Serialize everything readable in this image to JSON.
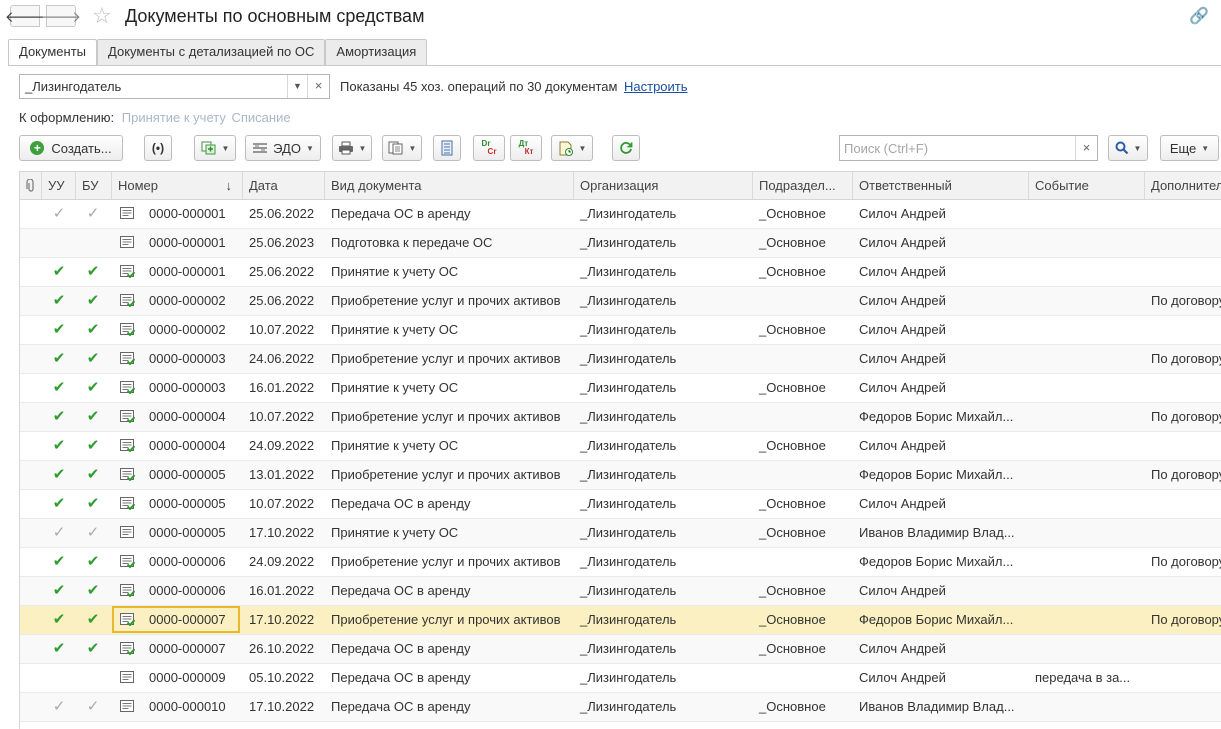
{
  "window": {
    "title": "Документы по основным средствам",
    "back": "🡐",
    "forward": "🡒",
    "favorite": "☆",
    "link": "🔗"
  },
  "tabs": [
    {
      "label": "Документы",
      "active": true
    },
    {
      "label": "Документы с детализацией по ОС",
      "active": false
    },
    {
      "label": "Амортизация",
      "active": false
    }
  ],
  "filter": {
    "value": "_Лизингодатель",
    "dropdown": "▼",
    "clear": "×"
  },
  "info": {
    "text": "Показаны 45 хоз. операций по 30 документам",
    "link": "Настроить"
  },
  "draft": {
    "label": "К оформлению:",
    "links": [
      "Принятие к учету",
      "Списание"
    ]
  },
  "toolbar": {
    "create": "Создать...",
    "edo": "ЭДО",
    "dt_kt": "Дт Кт",
    "search_placeholder": "Поиск (Ctrl+F)",
    "more": "Еще"
  },
  "columns": [
    "УУ",
    "БУ",
    "Номер",
    "Дата",
    "Вид документа",
    "Организация",
    "Подраздел...",
    "Ответственный",
    "Событие",
    "Дополнител"
  ],
  "sort_indicator": "↓",
  "rows": [
    {
      "uu": "grey",
      "bu": "grey",
      "posted": false,
      "number": "0000-000001",
      "date": "25.06.2022",
      "type": "Передача ОС в аренду",
      "org": "_Лизингодатель",
      "dept": "_Основное",
      "resp": "Силоч Андрей",
      "event": "",
      "extra": ""
    },
    {
      "uu": "",
      "bu": "",
      "posted": false,
      "number": "0000-000001",
      "date": "25.06.2023",
      "type": "Подготовка к передаче ОС",
      "org": "_Лизингодатель",
      "dept": "_Основное",
      "resp": "Силоч Андрей",
      "event": "",
      "extra": ""
    },
    {
      "uu": "green",
      "bu": "green",
      "posted": true,
      "number": "0000-000001",
      "date": "25.06.2022",
      "type": "Принятие к учету ОС",
      "org": "_Лизингодатель",
      "dept": "_Основное",
      "resp": "Силоч Андрей",
      "event": "",
      "extra": ""
    },
    {
      "uu": "green",
      "bu": "green",
      "posted": true,
      "number": "0000-000002",
      "date": "25.06.2022",
      "type": "Приобретение услуг и прочих активов",
      "org": "_Лизингодатель",
      "dept": "",
      "resp": "Силоч Андрей",
      "event": "",
      "extra": "По договору"
    },
    {
      "uu": "green",
      "bu": "green",
      "posted": true,
      "number": "0000-000002",
      "date": "10.07.2022",
      "type": "Принятие к учету ОС",
      "org": "_Лизингодатель",
      "dept": "_Основное",
      "resp": "Силоч Андрей",
      "event": "",
      "extra": ""
    },
    {
      "uu": "green",
      "bu": "green",
      "posted": true,
      "number": "0000-000003",
      "date": "24.06.2022",
      "type": "Приобретение услуг и прочих активов",
      "org": "_Лизингодатель",
      "dept": "",
      "resp": "Силоч Андрей",
      "event": "",
      "extra": "По договору"
    },
    {
      "uu": "green",
      "bu": "green",
      "posted": true,
      "number": "0000-000003",
      "date": "16.01.2022",
      "type": "Принятие к учету ОС",
      "org": "_Лизингодатель",
      "dept": "_Основное",
      "resp": "Силоч Андрей",
      "event": "",
      "extra": ""
    },
    {
      "uu": "green",
      "bu": "green",
      "posted": true,
      "number": "0000-000004",
      "date": "10.07.2022",
      "type": "Приобретение услуг и прочих активов",
      "org": "_Лизингодатель",
      "dept": "",
      "resp": "Федоров Борис Михайл...",
      "event": "",
      "extra": "По договору"
    },
    {
      "uu": "green",
      "bu": "green",
      "posted": true,
      "number": "0000-000004",
      "date": "24.09.2022",
      "type": "Принятие к учету ОС",
      "org": "_Лизингодатель",
      "dept": "_Основное",
      "resp": "Силоч Андрей",
      "event": "",
      "extra": ""
    },
    {
      "uu": "green",
      "bu": "green",
      "posted": true,
      "number": "0000-000005",
      "date": "13.01.2022",
      "type": "Приобретение услуг и прочих активов",
      "org": "_Лизингодатель",
      "dept": "",
      "resp": "Федоров Борис Михайл...",
      "event": "",
      "extra": "По договору"
    },
    {
      "uu": "green",
      "bu": "green",
      "posted": true,
      "number": "0000-000005",
      "date": "10.07.2022",
      "type": "Передача ОС в аренду",
      "org": "_Лизингодатель",
      "dept": "_Основное",
      "resp": "Силоч Андрей",
      "event": "",
      "extra": ""
    },
    {
      "uu": "grey",
      "bu": "grey",
      "posted": false,
      "number": "0000-000005",
      "date": "17.10.2022",
      "type": "Принятие к учету ОС",
      "org": "_Лизингодатель",
      "dept": "_Основное",
      "resp": "Иванов Владимир Влад...",
      "event": "",
      "extra": ""
    },
    {
      "uu": "green",
      "bu": "green",
      "posted": true,
      "number": "0000-000006",
      "date": "24.09.2022",
      "type": "Приобретение услуг и прочих активов",
      "org": "_Лизингодатель",
      "dept": "",
      "resp": "Федоров Борис Михайл...",
      "event": "",
      "extra": "По договору"
    },
    {
      "uu": "green",
      "bu": "green",
      "posted": true,
      "number": "0000-000006",
      "date": "16.01.2022",
      "type": "Передача ОС в аренду",
      "org": "_Лизингодатель",
      "dept": "_Основное",
      "resp": "Силоч Андрей",
      "event": "",
      "extra": ""
    },
    {
      "uu": "green",
      "bu": "green",
      "posted": true,
      "number": "0000-000007",
      "date": "17.10.2022",
      "type": "Приобретение услуг и прочих активов",
      "org": "_Лизингодатель",
      "dept": "_Основное",
      "resp": "Федоров Борис Михайл...",
      "event": "",
      "extra": "По договору",
      "selected": true
    },
    {
      "uu": "green",
      "bu": "green",
      "posted": true,
      "number": "0000-000007",
      "date": "26.10.2022",
      "type": "Передача ОС в аренду",
      "org": "_Лизингодатель",
      "dept": "_Основное",
      "resp": "Силоч Андрей",
      "event": "",
      "extra": ""
    },
    {
      "uu": "",
      "bu": "",
      "posted": false,
      "number": "0000-000009",
      "date": "05.10.2022",
      "type": "Передача ОС в аренду",
      "org": "_Лизингодатель",
      "dept": "",
      "resp": "Силоч Андрей",
      "event": "передача в за...",
      "extra": ""
    },
    {
      "uu": "grey",
      "bu": "grey",
      "posted": false,
      "number": "0000-000010",
      "date": "17.10.2022",
      "type": "Передача ОС в аренду",
      "org": "_Лизингодатель",
      "dept": "_Основное",
      "resp": "Иванов Владимир Влад...",
      "event": "",
      "extra": ""
    }
  ]
}
